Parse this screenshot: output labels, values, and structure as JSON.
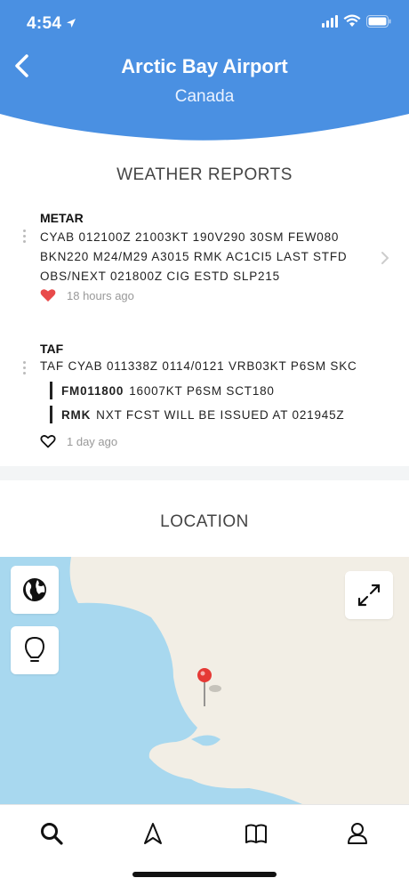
{
  "status_bar": {
    "time": "4:54"
  },
  "header": {
    "title": "Arctic Bay Airport",
    "subtitle": "Canada"
  },
  "weather": {
    "section_title": "WEATHER REPORTS",
    "metar": {
      "type": "METAR",
      "lines": [
        "CYAB 012100Z 21003KT 190V290 30SM FEW080",
        "BKN220 M24/M29 A3015 RMK AC1CI5 LAST STFD",
        "OBS/NEXT 021800Z CIG ESTD SLP215"
      ],
      "time_ago": "18 hours ago",
      "favorited": true
    },
    "taf": {
      "type": "TAF",
      "line": "TAF CYAB 011338Z 0114/0121 VRB03KT P6SM SKC",
      "groups": [
        {
          "code": "FM011800",
          "text": "16007KT P6SM SCT180"
        },
        {
          "code": "RMK",
          "text": "NXT FCST WILL BE ISSUED AT 021945Z"
        }
      ],
      "time_ago": "1 day ago",
      "favorited": false
    }
  },
  "location": {
    "section_title": "LOCATION"
  },
  "colors": {
    "header_blue": "#4a90e2",
    "heart_red": "#e84a4a",
    "water": "#a8d8ef",
    "land": "#f2eee5",
    "pin": "#e53935"
  },
  "icons": {
    "map_buttons": [
      "globe-icon",
      "lightbulb-icon",
      "expand-icon"
    ],
    "tabs": [
      "search-icon",
      "navigation-icon",
      "map-icon",
      "profile-icon"
    ]
  }
}
